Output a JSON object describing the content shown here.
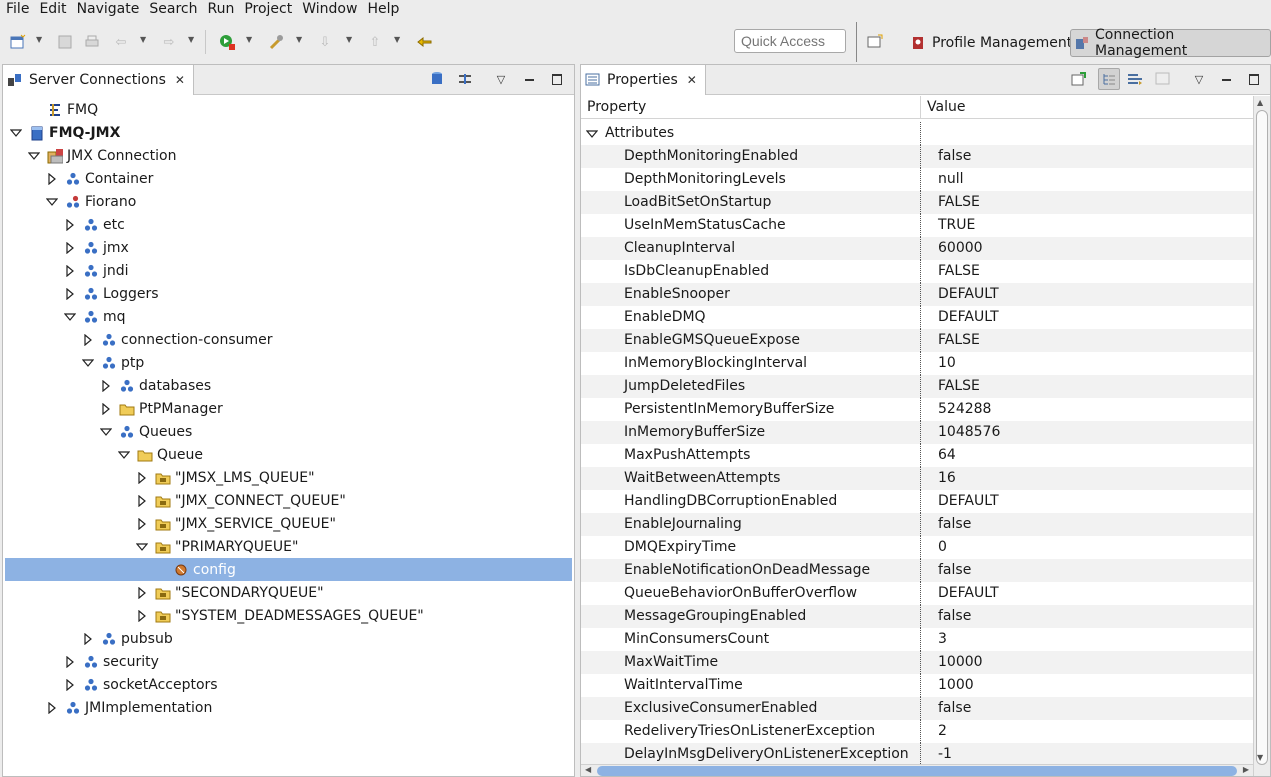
{
  "menu": [
    "File",
    "Edit",
    "Navigate",
    "Search",
    "Run",
    "Project",
    "Window",
    "Help"
  ],
  "toolbar": {
    "quick_access_placeholder": "Quick Access",
    "profile_management": "Profile Management",
    "connection_management": "Connection Management"
  },
  "left_pane": {
    "tab_label": "Server Connections",
    "tree": [
      {
        "label": "FMQ",
        "depth": 1,
        "arrow": "none",
        "icon": "fmq-icon"
      },
      {
        "label": "FMQ-JMX",
        "depth": 0,
        "arrow": "down",
        "icon": "server-icon",
        "bold": true
      },
      {
        "label": "JMX Connection",
        "depth": 1,
        "arrow": "down",
        "icon": "connection-icon"
      },
      {
        "label": "Container",
        "depth": 2,
        "arrow": "right",
        "icon": "mbean-icon"
      },
      {
        "label": "Fiorano",
        "depth": 2,
        "arrow": "down",
        "icon": "mbean-red-icon"
      },
      {
        "label": "etc",
        "depth": 3,
        "arrow": "right",
        "icon": "mbean-icon"
      },
      {
        "label": "jmx",
        "depth": 3,
        "arrow": "right",
        "icon": "mbean-icon"
      },
      {
        "label": "jndi",
        "depth": 3,
        "arrow": "right",
        "icon": "mbean-icon"
      },
      {
        "label": "Loggers",
        "depth": 3,
        "arrow": "right",
        "icon": "mbean-icon"
      },
      {
        "label": "mq",
        "depth": 3,
        "arrow": "down",
        "icon": "mbean-icon"
      },
      {
        "label": "connection-consumer",
        "depth": 4,
        "arrow": "right",
        "icon": "mbean-icon"
      },
      {
        "label": "ptp",
        "depth": 4,
        "arrow": "down",
        "icon": "mbean-icon"
      },
      {
        "label": "databases",
        "depth": 5,
        "arrow": "right",
        "icon": "mbean-icon"
      },
      {
        "label": "PtPManager",
        "depth": 5,
        "arrow": "right",
        "icon": "folder-icon"
      },
      {
        "label": "Queues",
        "depth": 5,
        "arrow": "down",
        "icon": "mbean-icon"
      },
      {
        "label": "Queue",
        "depth": 6,
        "arrow": "down",
        "icon": "folder-icon"
      },
      {
        "label": "\"JMSX_LMS_QUEUE\"",
        "depth": 7,
        "arrow": "right",
        "icon": "queue-folder-icon"
      },
      {
        "label": "\"JMX_CONNECT_QUEUE\"",
        "depth": 7,
        "arrow": "right",
        "icon": "queue-folder-icon"
      },
      {
        "label": "\"JMX_SERVICE_QUEUE\"",
        "depth": 7,
        "arrow": "right",
        "icon": "queue-folder-icon"
      },
      {
        "label": "\"PRIMARYQUEUE\"",
        "depth": 7,
        "arrow": "down",
        "icon": "queue-folder-icon"
      },
      {
        "label": "config",
        "depth": 8,
        "arrow": "none",
        "icon": "config-icon",
        "selected": true
      },
      {
        "label": "\"SECONDARYQUEUE\"",
        "depth": 7,
        "arrow": "right",
        "icon": "queue-folder-icon"
      },
      {
        "label": "\"SYSTEM_DEADMESSAGES_QUEUE\"",
        "depth": 7,
        "arrow": "right",
        "icon": "queue-folder-icon"
      },
      {
        "label": "pubsub",
        "depth": 4,
        "arrow": "right",
        "icon": "mbean-icon"
      },
      {
        "label": "security",
        "depth": 3,
        "arrow": "right",
        "icon": "mbean-icon"
      },
      {
        "label": "socketAcceptors",
        "depth": 3,
        "arrow": "right",
        "icon": "mbean-icon"
      },
      {
        "label": "JMImplementation",
        "depth": 2,
        "arrow": "right",
        "icon": "mbean-icon"
      }
    ]
  },
  "right_pane": {
    "tab_label": "Properties",
    "col_property": "Property",
    "col_value": "Value",
    "category": "Attributes",
    "rows": [
      {
        "name": "DepthMonitoringEnabled",
        "value": "false"
      },
      {
        "name": "DepthMonitoringLevels",
        "value": "null"
      },
      {
        "name": "LoadBitSetOnStartup",
        "value": "FALSE"
      },
      {
        "name": "UseInMemStatusCache",
        "value": "TRUE"
      },
      {
        "name": "CleanupInterval",
        "value": "60000"
      },
      {
        "name": "IsDbCleanupEnabled",
        "value": "FALSE"
      },
      {
        "name": "EnableSnooper",
        "value": "DEFAULT"
      },
      {
        "name": "EnableDMQ",
        "value": "DEFAULT"
      },
      {
        "name": "EnableGMSQueueExpose",
        "value": "FALSE"
      },
      {
        "name": "InMemoryBlockingInterval",
        "value": "10"
      },
      {
        "name": "JumpDeletedFiles",
        "value": "FALSE"
      },
      {
        "name": "PersistentInMemoryBufferSize",
        "value": "524288"
      },
      {
        "name": "InMemoryBufferSize",
        "value": "1048576"
      },
      {
        "name": "MaxPushAttempts",
        "value": "64"
      },
      {
        "name": "WaitBetweenAttempts",
        "value": "16"
      },
      {
        "name": "HandlingDBCorruptionEnabled",
        "value": "DEFAULT"
      },
      {
        "name": "EnableJournaling",
        "value": "false"
      },
      {
        "name": "DMQExpiryTime",
        "value": "0"
      },
      {
        "name": "EnableNotificationOnDeadMessage",
        "value": "false"
      },
      {
        "name": "QueueBehaviorOnBufferOverflow",
        "value": "DEFAULT"
      },
      {
        "name": "MessageGroupingEnabled",
        "value": "false"
      },
      {
        "name": "MinConsumersCount",
        "value": "3"
      },
      {
        "name": "MaxWaitTime",
        "value": "10000"
      },
      {
        "name": "WaitIntervalTime",
        "value": "1000"
      },
      {
        "name": "ExclusiveConsumerEnabled",
        "value": "false"
      },
      {
        "name": "RedeliveryTriesOnListenerException",
        "value": "2"
      },
      {
        "name": "DelayInMsgDeliveryOnListenerException",
        "value": "-1"
      }
    ]
  },
  "colors": {
    "selection": "#8db2e3",
    "mbean_blue": "#3a6fc4",
    "folder_yellow": "#e8c04a"
  }
}
